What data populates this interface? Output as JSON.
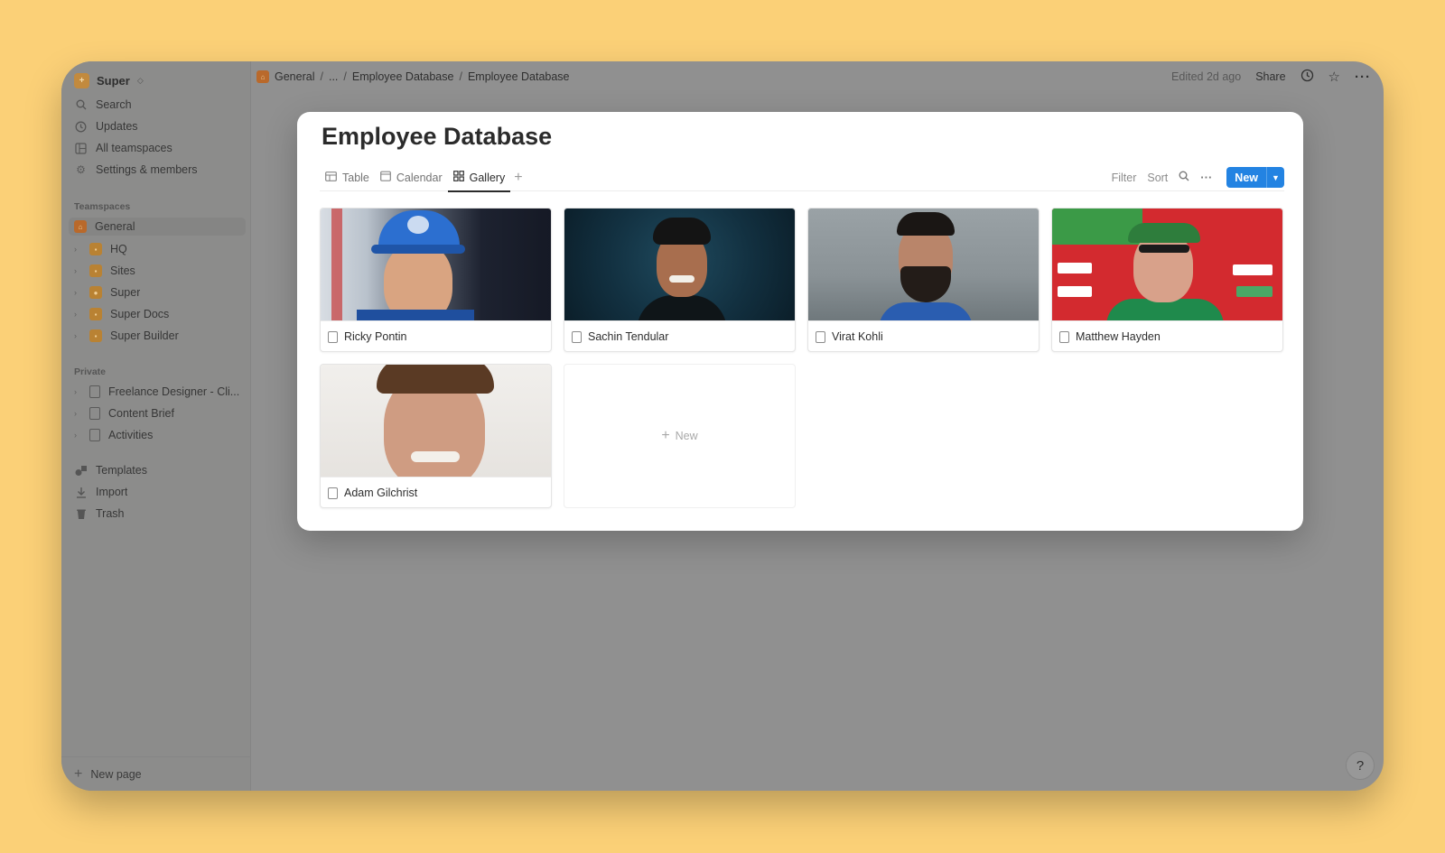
{
  "sidebar": {
    "workspace": {
      "name": "Super",
      "logo": "+"
    },
    "top_items": [
      {
        "label": "Search",
        "icon": "search-icon"
      },
      {
        "label": "Updates",
        "icon": "clock-icon"
      },
      {
        "label": "All teamspaces",
        "icon": "grid-icon"
      },
      {
        "label": "Settings & members",
        "icon": "gear-icon"
      }
    ],
    "teamspaces_title": "Teamspaces",
    "teamspaces": [
      {
        "label": "General"
      },
      {
        "label": "HQ"
      },
      {
        "label": "Sites"
      },
      {
        "label": "Super"
      },
      {
        "label": "Super Docs"
      },
      {
        "label": "Super Builder"
      }
    ],
    "private_title": "Private",
    "private": [
      {
        "label": "Freelance Designer - Cli..."
      },
      {
        "label": "Content Brief"
      },
      {
        "label": "Activities"
      }
    ],
    "bottom_items": [
      {
        "label": "Templates",
        "icon": "shapes-icon"
      },
      {
        "label": "Import",
        "icon": "download-icon"
      },
      {
        "label": "Trash",
        "icon": "trash-icon"
      }
    ],
    "new_page": "New page"
  },
  "topbar": {
    "crumbs": [
      "General",
      "...",
      "Employee Database",
      "Employee Database"
    ],
    "edited": "Edited 2d ago",
    "share": "Share"
  },
  "database": {
    "title": "Employee Database",
    "tabs": [
      {
        "label": "Table",
        "active": false
      },
      {
        "label": "Calendar",
        "active": false
      },
      {
        "label": "Gallery",
        "active": true
      }
    ],
    "tools": {
      "filter": "Filter",
      "sort": "Sort",
      "new": "New"
    },
    "cards": [
      {
        "name": "Ricky Pontin"
      },
      {
        "name": "Sachin Tendular"
      },
      {
        "name": "Virat Kohli"
      },
      {
        "name": "Matthew Hayden"
      },
      {
        "name": "Adam Gilchrist"
      }
    ],
    "new_card": "New"
  },
  "help": "?"
}
